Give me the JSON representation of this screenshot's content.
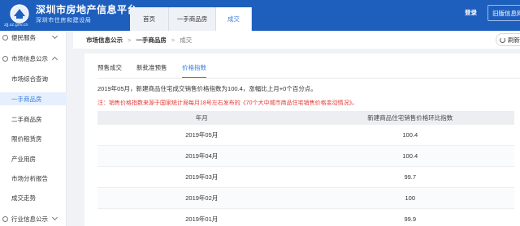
{
  "header": {
    "logo_domain": "zjj.sz.gov.cn",
    "title": "深圳市房地产信息平台",
    "subtitle": "深圳市住房和建设局",
    "tabs": [
      "首页",
      "一手商品房",
      "成交"
    ],
    "active_tab": 2,
    "login_label": "登录",
    "old_version_label": "旧版信息网"
  },
  "sidebar": {
    "group1": "便民服务",
    "group2": "市场信息公示",
    "items": [
      "市场综合查询",
      "一手商品房",
      "二手商品房",
      "限价租赁房",
      "产业用房",
      "市场分析报告",
      "成交走势"
    ],
    "active_item": 1,
    "group3": "行业信息公示"
  },
  "breadcrumb": {
    "items": [
      "市场信息公示",
      "一手商品房",
      "成交"
    ],
    "sep": ">",
    "refresh_label": "刷新"
  },
  "main": {
    "subtabs": [
      "预售成交",
      "新批准预售",
      "价格指数"
    ],
    "active_subtab": 2,
    "summary": "2019年05月，新建商品住宅成交销售价格指数为100.4，涨幅比上月+0个百分点。",
    "note": "注：销售价格指数来源于国家统计局每月18号左右发布的《70个大中城市商品住宅销售价格变动情况》。",
    "table": {
      "headers": [
        "年月",
        "新建商品住宅销售价格环比指数"
      ],
      "rows": [
        [
          "2019年05月",
          "100.4"
        ],
        [
          "2019年04月",
          "100.4"
        ],
        [
          "2019年03月",
          "99.7"
        ],
        [
          "2019年02月",
          "100"
        ],
        [
          "2019年01月",
          "99.9"
        ]
      ]
    }
  }
}
